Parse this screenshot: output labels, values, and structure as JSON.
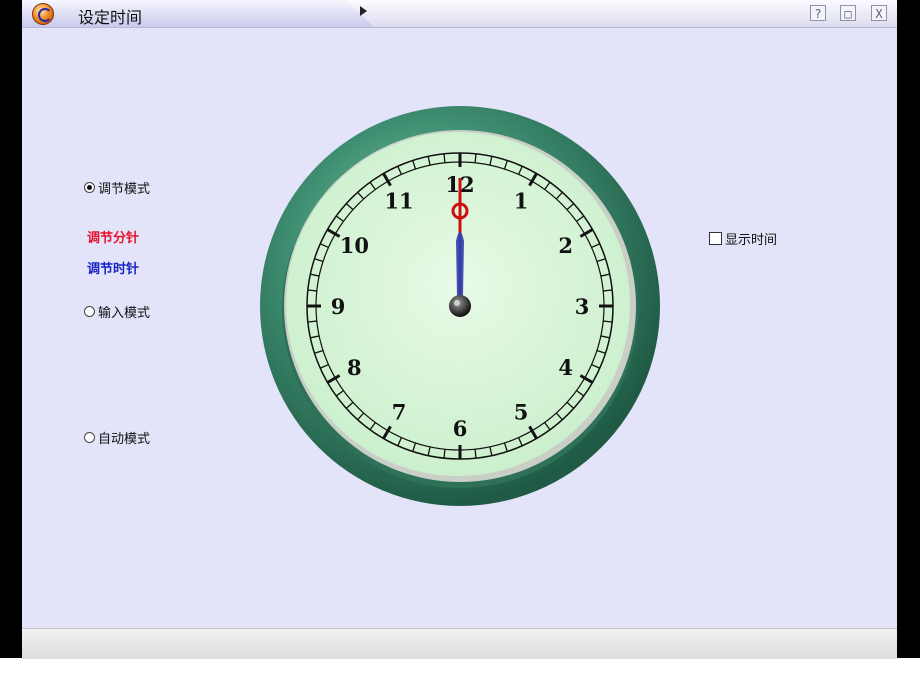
{
  "window": {
    "title": "设定时间",
    "help_label": "?",
    "restore_label": "□",
    "close_label": "X"
  },
  "modes": {
    "adjust": {
      "label": "调节模式",
      "selected": true
    },
    "input": {
      "label": "输入模式",
      "selected": false
    },
    "auto": {
      "label": "自动模式",
      "selected": false
    }
  },
  "adjust_links": {
    "minute": {
      "label": "调节分针",
      "color": "#e8142c"
    },
    "hour": {
      "label": "调节时针",
      "color": "#1826c8"
    }
  },
  "show_time": {
    "label": "显示时间",
    "checked": false
  },
  "clock": {
    "numbers": [
      "12",
      "1",
      "2",
      "3",
      "4",
      "5",
      "6",
      "7",
      "8",
      "9",
      "10",
      "11"
    ],
    "time": {
      "hour": 12,
      "minute": 0
    },
    "colors": {
      "bezel": "#3f8f72",
      "face": "#d9f4d8",
      "minute_hand": "#cc1010",
      "hour_hand": "#2e3fb3"
    }
  },
  "colors": {
    "content_bg": "#e3e3fa",
    "frame": "#000000"
  }
}
